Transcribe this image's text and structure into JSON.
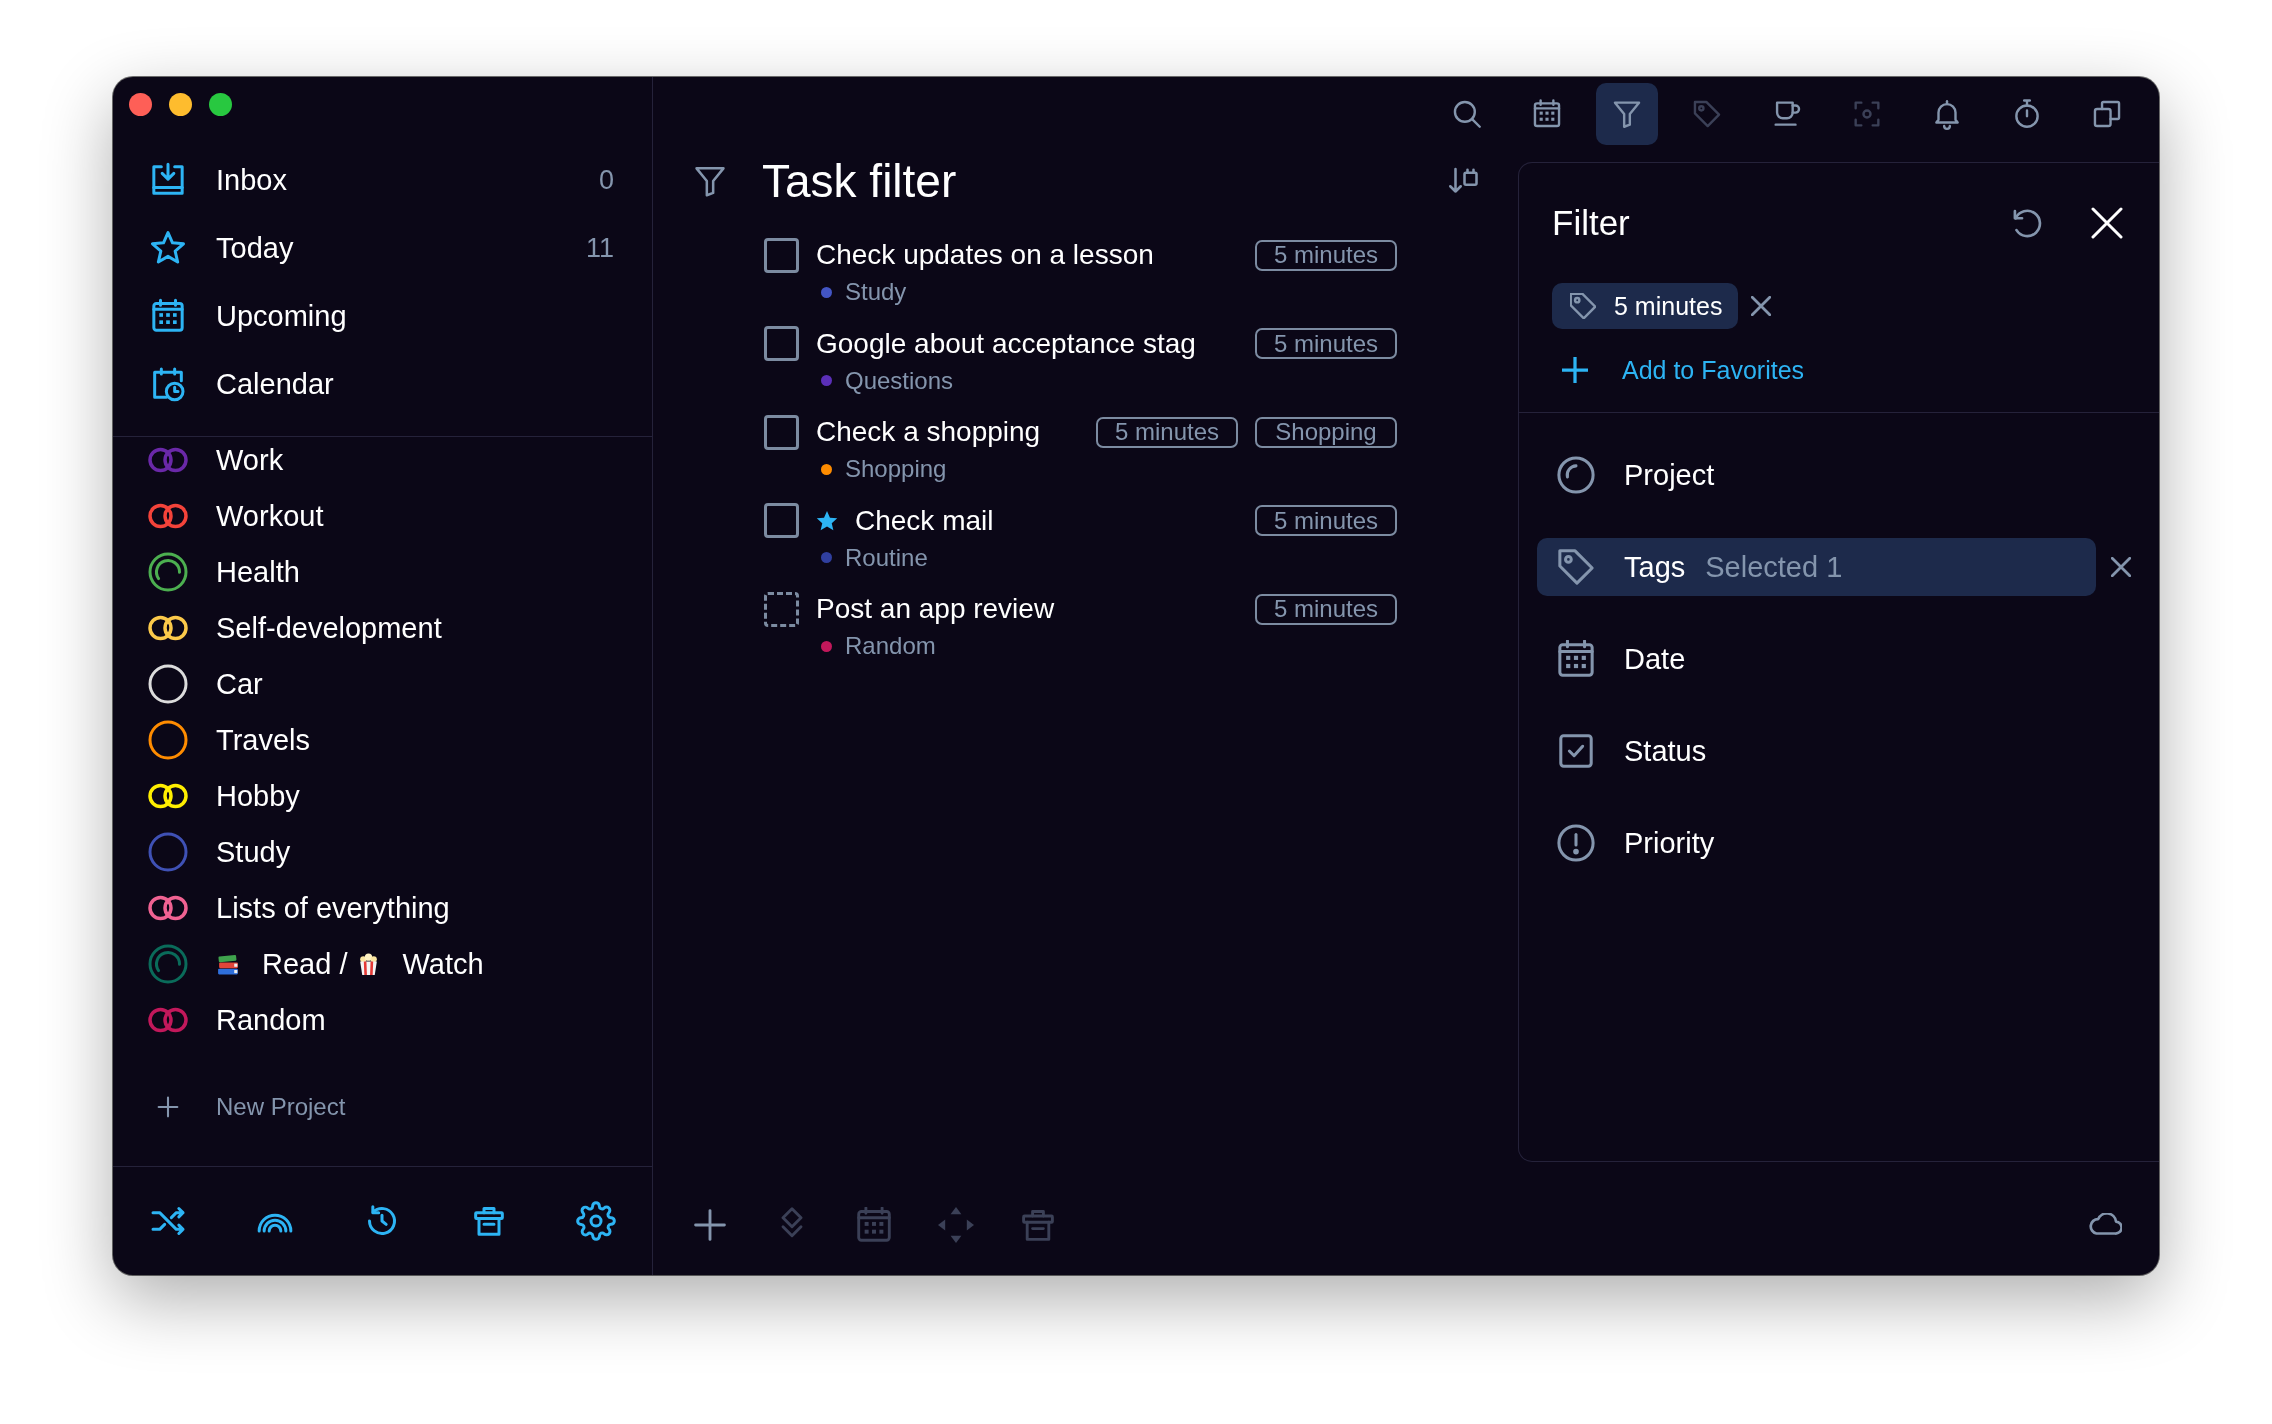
{
  "sidebar": {
    "nav": [
      {
        "kind": "inbox",
        "label": "Inbox",
        "count": "0",
        "selected": false
      },
      {
        "kind": "today",
        "label": "Today",
        "count": "11",
        "selected": false
      },
      {
        "kind": "upcoming",
        "label": "Upcoming",
        "selected": false
      },
      {
        "kind": "calendar",
        "label": "Calendar",
        "selected": false
      }
    ],
    "projects": [
      {
        "kind": "linked",
        "name": "Work",
        "color": "#6a28a8",
        "selected": false
      },
      {
        "kind": "linked",
        "name": "Workout",
        "color": "#f4433a",
        "selected": false
      },
      {
        "kind": "progress",
        "name": "Health",
        "color": "#4caf50",
        "selected": false
      },
      {
        "kind": "linked",
        "name": "Self-development",
        "color": "#fbc94a",
        "selected": false
      },
      {
        "kind": "ring",
        "name": "Car",
        "color": "#dcdcdc",
        "selected": false
      },
      {
        "kind": "ring",
        "name": "Travels",
        "color": "#ff8c00",
        "selected": false
      },
      {
        "kind": "linked",
        "name": "Hobby",
        "color": "#ffee00",
        "selected": false
      },
      {
        "kind": "ring",
        "name": "Study",
        "color": "#3f51b5",
        "selected": false
      },
      {
        "kind": "linked",
        "name": "Lists of everything",
        "color": "#f06292",
        "selected": false
      },
      {
        "kind": "progress",
        "name_parts": [
          {
            "kind": "books"
          },
          {
            "kind": "text",
            "text": "Read /"
          },
          {
            "kind": "popcorn"
          },
          {
            "kind": "text",
            "text": "Watch"
          }
        ],
        "color": "#0a6b5a",
        "selected": false
      },
      {
        "kind": "linked",
        "name": "Random",
        "color": "#c2185b",
        "selected": false
      }
    ],
    "new_project": "New Project"
  },
  "toolbar": [
    {
      "kind": "search",
      "selected": false,
      "disabled": false
    },
    {
      "kind": "calendar",
      "selected": false,
      "disabled": false
    },
    {
      "kind": "filter",
      "selected": true,
      "disabled": false
    },
    {
      "kind": "tag",
      "selected": false,
      "disabled": true
    },
    {
      "kind": "cup",
      "selected": false,
      "disabled": false
    },
    {
      "kind": "focus",
      "selected": false,
      "disabled": true
    },
    {
      "kind": "bell",
      "selected": false,
      "disabled": false
    },
    {
      "kind": "timer",
      "selected": false,
      "disabled": false
    },
    {
      "kind": "copy",
      "selected": false,
      "disabled": false
    }
  ],
  "main": {
    "title": "Task filter",
    "tasks": [
      {
        "kind": "solid",
        "title": "Check updates on a lesson",
        "checked": false,
        "starred": false,
        "project": {
          "name": "Study",
          "color": "#4355c4"
        },
        "tags": [
          "5 minutes"
        ]
      },
      {
        "kind": "solid",
        "title": "Google about acceptance stag",
        "checked": false,
        "starred": false,
        "project": {
          "name": "Questions",
          "color": "#5b2fb8"
        },
        "tags": [
          "5 minutes"
        ]
      },
      {
        "kind": "solid",
        "title": "Check a shopping",
        "checked": false,
        "starred": false,
        "project": {
          "name": "Shopping",
          "color": "#ff8c00"
        },
        "tags": [
          "5 minutes",
          "Shopping"
        ]
      },
      {
        "kind": "solid",
        "title": "Check mail",
        "checked": false,
        "starred": true,
        "project": {
          "name": "Routine",
          "color": "#303f9f"
        },
        "tags": [
          "5 minutes"
        ]
      },
      {
        "kind": "dashed",
        "title": "Post an app review",
        "checked": false,
        "starred": false,
        "project": {
          "name": "Random",
          "color": "#c2185b"
        },
        "tags": [
          "5 minutes"
        ]
      }
    ],
    "actions": [
      {
        "kind": "plus",
        "disabled": false
      },
      {
        "kind": "diamond",
        "disabled": true
      },
      {
        "kind": "calendar",
        "disabled": true
      },
      {
        "kind": "arrows",
        "disabled": true
      },
      {
        "kind": "trash",
        "disabled": true
      }
    ]
  },
  "filter": {
    "title": "Filter",
    "chips": [
      "5 minutes"
    ],
    "favorites_link": "Add to Favorites",
    "categories": [
      {
        "kind": "project",
        "label": "Project",
        "selected": false
      },
      {
        "kind": "tags",
        "label": "Tags",
        "value": "Selected 1",
        "selected": true
      },
      {
        "kind": "date",
        "label": "Date",
        "selected": false
      },
      {
        "kind": "status",
        "label": "Status",
        "selected": false
      },
      {
        "kind": "priority",
        "label": "Priority",
        "selected": false
      }
    ]
  }
}
